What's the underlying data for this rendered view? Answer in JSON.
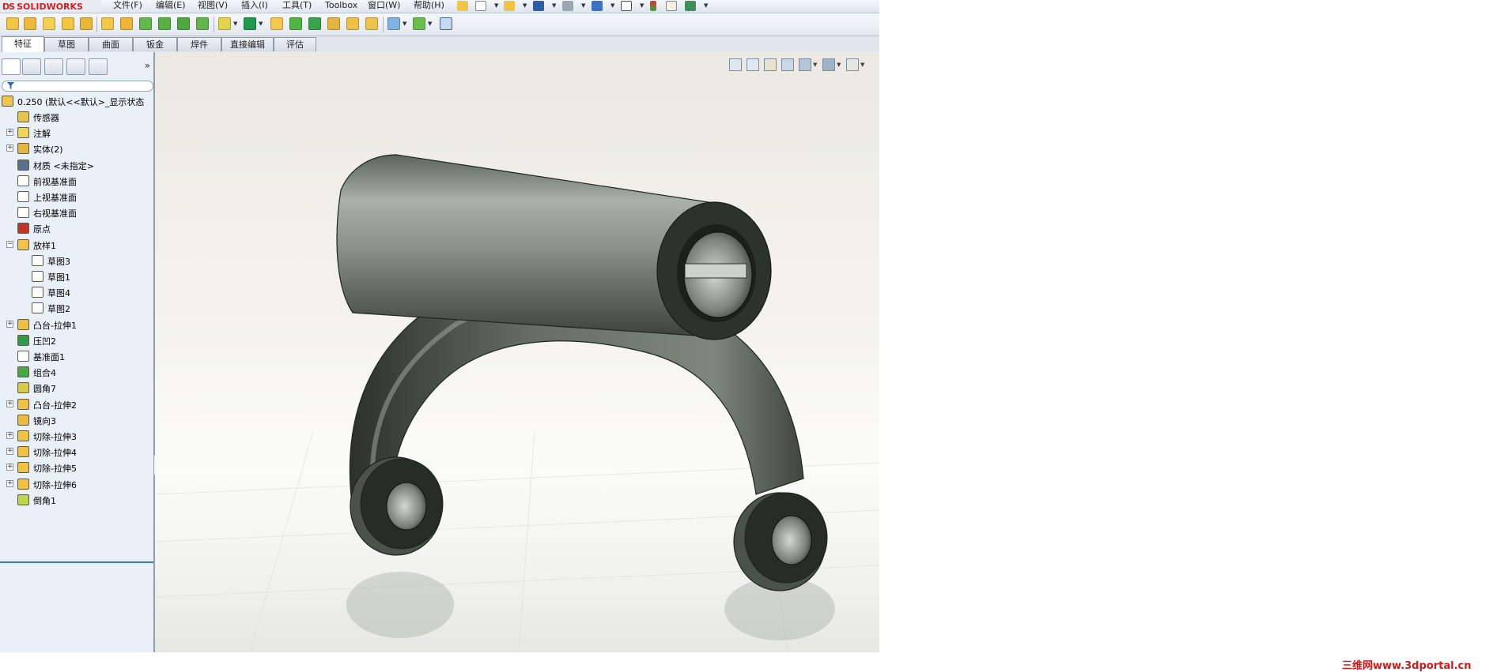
{
  "app": {
    "brand": "SOLIDWORKS",
    "brand_prefix": "DS",
    "menu": [
      "文件(F)",
      "编辑(E)",
      "视图(V)",
      "插入(I)",
      "工具(T)",
      "Toolbox",
      "窗口(W)",
      "帮助(H)"
    ]
  },
  "tabs": [
    "特征",
    "草图",
    "曲面",
    "钣金",
    "焊件",
    "直接编辑",
    "评估"
  ],
  "active_tab": "特征",
  "feature_tree": {
    "root": "0.250  (默认<<默认>_显示状态",
    "items": [
      {
        "label": "传感器",
        "icon": "sensor-icon",
        "expandable": false
      },
      {
        "label": "注解",
        "icon": "annotations-icon",
        "expandable": true
      },
      {
        "label": "实体(2)",
        "icon": "solid-bodies-icon",
        "expandable": true
      },
      {
        "label": "材质 <未指定>",
        "icon": "material-icon",
        "expandable": false
      },
      {
        "label": "前视基准面",
        "icon": "plane-icon",
        "expandable": false
      },
      {
        "label": "上视基准面",
        "icon": "plane-icon",
        "expandable": false
      },
      {
        "label": "右视基准面",
        "icon": "plane-icon",
        "expandable": false
      },
      {
        "label": "原点",
        "icon": "origin-icon",
        "expandable": false
      },
      {
        "label": "放样1",
        "icon": "loft-icon",
        "expandable": true,
        "expanded": true
      },
      {
        "label": "草图3",
        "icon": "sketch-icon",
        "child": true
      },
      {
        "label": "草图1",
        "icon": "sketch-icon",
        "child": true
      },
      {
        "label": "草图4",
        "icon": "sketch-icon",
        "child": true
      },
      {
        "label": "草图2",
        "icon": "sketch-icon",
        "child": true
      },
      {
        "label": "凸台-拉伸1",
        "icon": "boss-extrude-icon",
        "expandable": true
      },
      {
        "label": "压凹2",
        "icon": "indent-icon",
        "expandable": false
      },
      {
        "label": "基准面1",
        "icon": "plane-icon",
        "expandable": false
      },
      {
        "label": "组合4",
        "icon": "combine-icon",
        "expandable": false
      },
      {
        "label": "圆角7",
        "icon": "fillet-icon",
        "expandable": false
      },
      {
        "label": "凸台-拉伸2",
        "icon": "boss-extrude-icon",
        "expandable": true
      },
      {
        "label": "镜向3",
        "icon": "mirror-icon",
        "expandable": false
      },
      {
        "label": "切除-拉伸3",
        "icon": "cut-extrude-icon",
        "expandable": true
      },
      {
        "label": "切除-拉伸4",
        "icon": "cut-extrude-icon",
        "expandable": true
      },
      {
        "label": "切除-拉伸5",
        "icon": "cut-extrude-icon",
        "expandable": true
      },
      {
        "label": "切除-拉伸6",
        "icon": "cut-extrude-icon",
        "expandable": true
      },
      {
        "label": "倒角1",
        "icon": "chamfer-icon",
        "expandable": false
      }
    ]
  },
  "watermark": "三维网www.3dportal.cn",
  "colors": {
    "brand_red": "#d42020",
    "selection_blue": "#3b78c5",
    "part_gray": "#6f7a72"
  }
}
